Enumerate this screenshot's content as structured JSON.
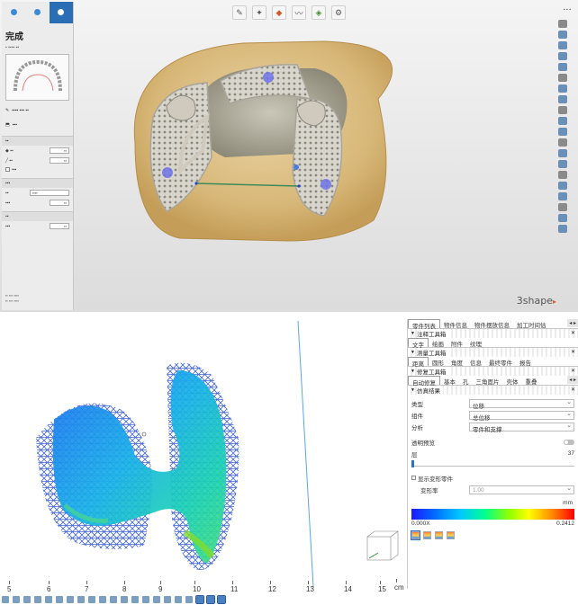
{
  "top_app": {
    "mode_tabs": [
      {
        "label": "",
        "active": false
      },
      {
        "label": "",
        "active": false
      },
      {
        "label": "",
        "active": true
      }
    ],
    "panel_title": "完成",
    "brand": "3shape",
    "brand_color": "#e0583a"
  },
  "sim_app": {
    "tabrow1": {
      "tabs": [
        "零件列表",
        "物件信息",
        "物件摆放信息",
        "加工时间估"
      ],
      "active_index": 0
    },
    "note_tools": {
      "title": "注释工具箱",
      "tabs": [
        "文字",
        "绘画",
        "附件",
        "纹理"
      ],
      "active_index": 0
    },
    "measure_tools": {
      "title": "测量工具箱",
      "tabs": [
        "距离",
        "圆形",
        "角度",
        "信息",
        "最终零件",
        "报告"
      ],
      "active_index": 0
    },
    "repair_tools": {
      "title": "修复工具箱",
      "tabs": [
        "自动修复",
        "基本",
        "孔",
        "三角面片",
        "壳体",
        "重叠"
      ],
      "active_index": 0
    },
    "sim_result": {
      "title": "仿真结果",
      "rows": [
        {
          "key": "类型",
          "value": "位移"
        },
        {
          "key": "组件",
          "value": "总位移"
        },
        {
          "key": "分析",
          "value": "零件和支撑"
        }
      ],
      "transparency_label": "透明预览",
      "layer_label": "层",
      "layer_value": "37",
      "show_deform_label": "显示变形零件",
      "deform_rate_label": "变形率",
      "deform_rate_value": "1.00",
      "unit": "mm",
      "scale_min": "0.000X",
      "scale_max": "0.2412"
    },
    "axis_ticks": [
      "5",
      "6",
      "7",
      "8",
      "9",
      "10",
      "11",
      "12",
      "13",
      "14",
      "15"
    ],
    "axis_unit": "cm"
  }
}
